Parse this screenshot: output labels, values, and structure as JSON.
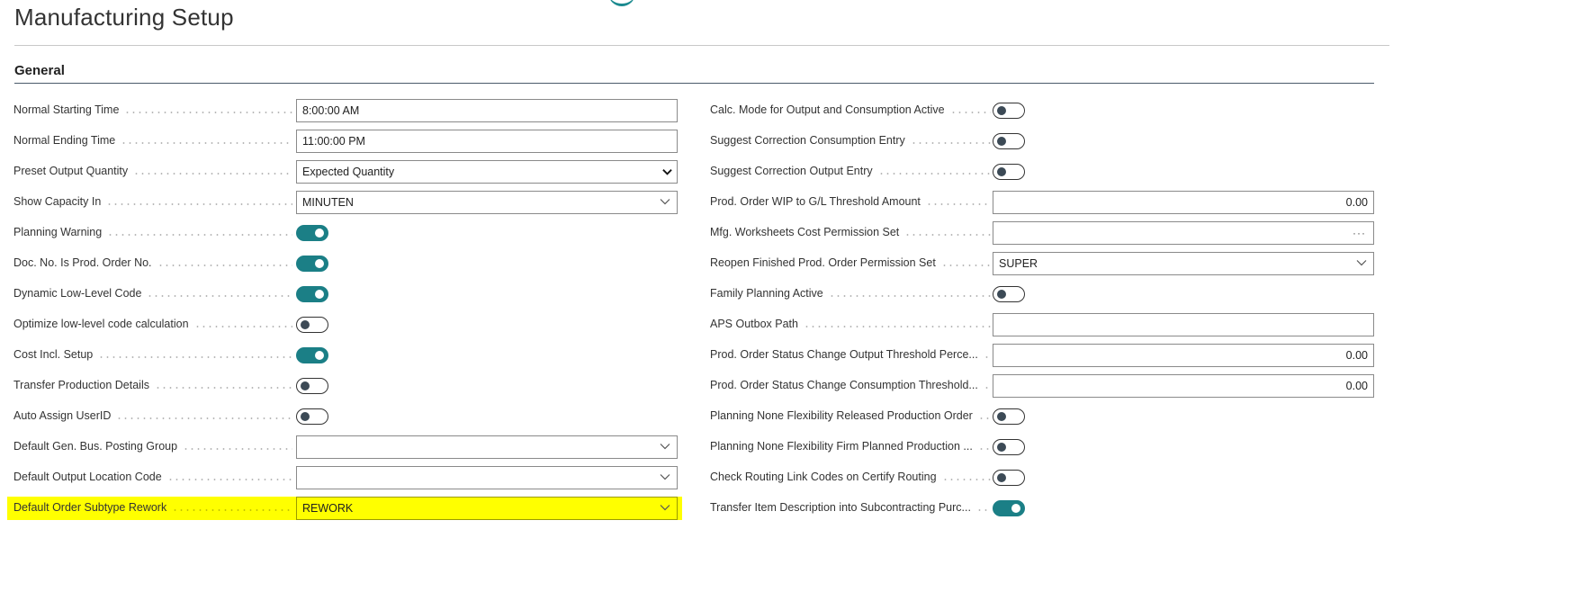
{
  "page": {
    "title": "Manufacturing Setup"
  },
  "section": {
    "title": "General"
  },
  "left_fields": [
    {
      "label": "Normal Starting Time",
      "type": "text",
      "value": "8:00:00 AM"
    },
    {
      "label": "Normal Ending Time",
      "type": "text",
      "value": "11:00:00 PM"
    },
    {
      "label": "Preset Output Quantity",
      "type": "select",
      "value": "Expected Quantity"
    },
    {
      "label": "Show Capacity In",
      "type": "dropdown",
      "value": "MINUTEN"
    },
    {
      "label": "Planning Warning",
      "type": "toggle",
      "on": true
    },
    {
      "label": "Doc. No. Is Prod. Order No.",
      "type": "toggle",
      "on": true
    },
    {
      "label": "Dynamic Low-Level Code",
      "type": "toggle",
      "on": true
    },
    {
      "label": "Optimize low-level code calculation",
      "type": "toggle",
      "on": false
    },
    {
      "label": "Cost Incl. Setup",
      "type": "toggle",
      "on": true
    },
    {
      "label": "Transfer Production Details",
      "type": "toggle",
      "on": false
    },
    {
      "label": "Auto Assign UserID",
      "type": "toggle",
      "on": false
    },
    {
      "label": "Default Gen. Bus. Posting Group",
      "type": "dropdown",
      "value": ""
    },
    {
      "label": "Default Output Location Code",
      "type": "dropdown",
      "value": ""
    },
    {
      "label": "Default Order Subtype Rework",
      "type": "dropdown",
      "value": "REWORK",
      "highlighted": true
    }
  ],
  "right_fields": [
    {
      "label": "Calc. Mode for Output and Consumption Active",
      "type": "toggle",
      "on": false
    },
    {
      "label": "Suggest Correction Consumption Entry",
      "type": "toggle",
      "on": false
    },
    {
      "label": "Suggest Correction Output Entry",
      "type": "toggle",
      "on": false
    },
    {
      "label": "Prod. Order WIP to G/L Threshold Amount",
      "type": "number",
      "value": "0.00"
    },
    {
      "label": "Mfg. Worksheets Cost Permission Set",
      "type": "lookup",
      "value": ""
    },
    {
      "label": "Reopen Finished Prod. Order Permission Set",
      "type": "dropdown",
      "value": "SUPER"
    },
    {
      "label": "Family Planning Active",
      "type": "toggle",
      "on": false
    },
    {
      "label": "APS Outbox Path",
      "type": "text",
      "value": ""
    },
    {
      "label": "Prod. Order Status Change Output Threshold Perce...",
      "type": "number",
      "value": "0.00"
    },
    {
      "label": "Prod. Order Status Change Consumption Threshold...",
      "type": "number",
      "value": "0.00"
    },
    {
      "label": "Planning None Flexibility Released Production Order",
      "type": "toggle",
      "on": false
    },
    {
      "label": "Planning None Flexibility Firm Planned Production ...",
      "type": "toggle",
      "on": false
    },
    {
      "label": "Check Routing Link Codes on Certify Routing",
      "type": "toggle",
      "on": false
    },
    {
      "label": "Transfer Item Description into Subcontracting Purc...",
      "type": "toggle",
      "on": true
    }
  ],
  "colors": {
    "accent": "#1b7f86",
    "highlight": "#ffff00",
    "rule": "#4a5a6a"
  },
  "icons": {
    "dropdown": "chevron-down-icon",
    "lookup": "ellipsis-icon"
  }
}
